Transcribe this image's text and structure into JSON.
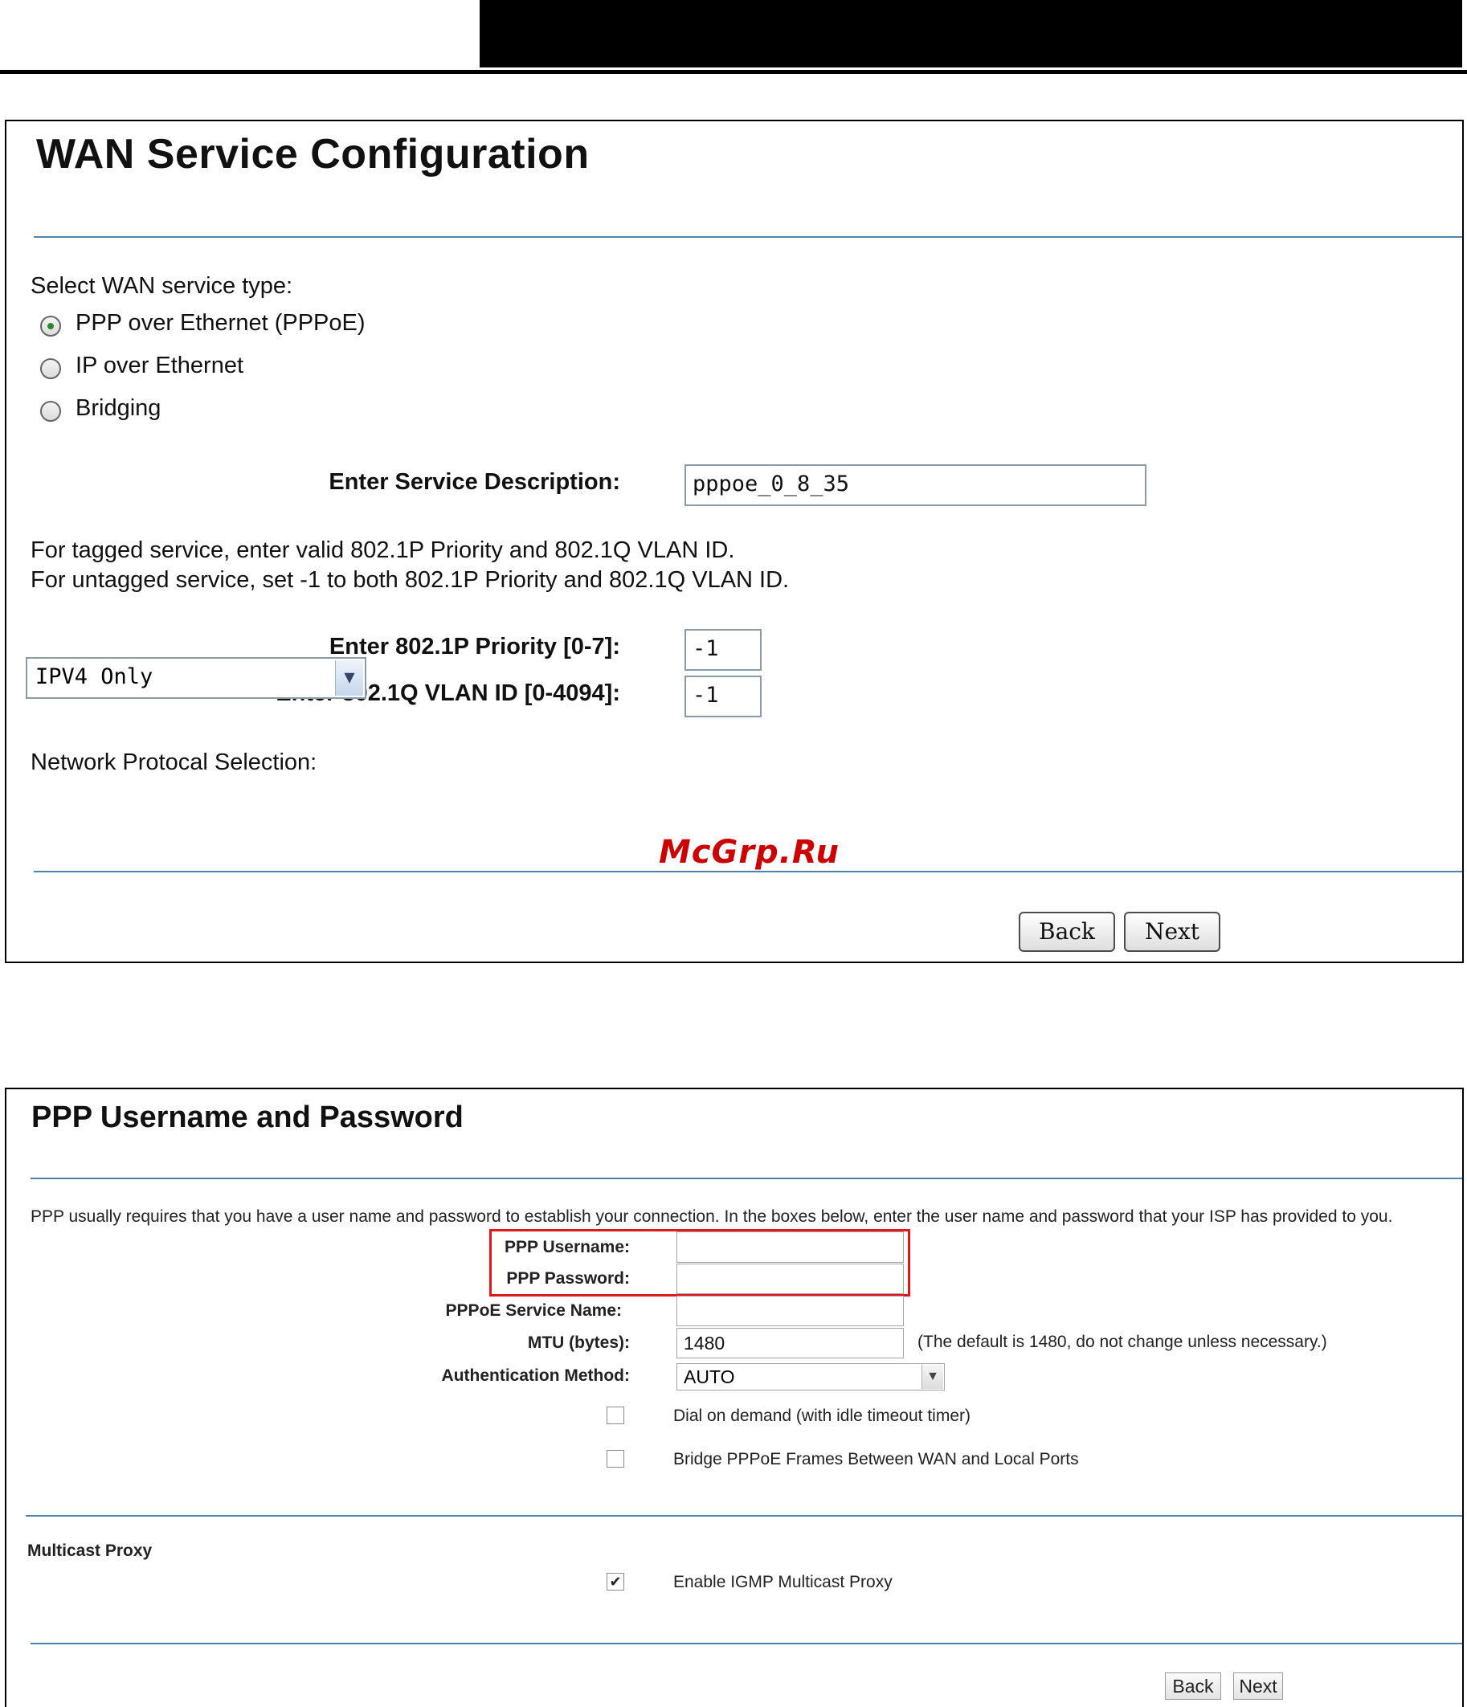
{
  "wan_service": {
    "title": "WAN Service Configuration",
    "select_label": "Select WAN service type:",
    "options": [
      {
        "label": "PPP over Ethernet (PPPoE)",
        "selected": true
      },
      {
        "label": "IP over Ethernet",
        "selected": false
      },
      {
        "label": "Bridging",
        "selected": false
      }
    ],
    "service_description_label": "Enter Service Description:",
    "service_description_value": "pppoe_0_8_35",
    "tagged_note": "For tagged service, enter valid 802.1P Priority and 802.1Q VLAN ID.",
    "untagged_note": "For untagged service, set -1 to both 802.1P Priority and 802.1Q VLAN ID.",
    "priority_label": "Enter 802.1P Priority [0-7]:",
    "priority_value": "-1",
    "vlan_label": "Enter 802.1Q VLAN ID [0-4094]:",
    "vlan_value": "-1",
    "protocol_label": "Network Protocal Selection:",
    "protocol_value": "IPV4 Only",
    "watermark": "McGrp.Ru",
    "back_label": "Back",
    "next_label": "Next"
  },
  "ppp": {
    "title": "PPP Username and Password",
    "intro": "PPP usually requires that you have a user name and password to establish your connection. In the boxes below, enter the user name and password that your ISP has provided to you.",
    "username_label": "PPP Username:",
    "username_value": "",
    "password_label": "PPP Password:",
    "password_value": "",
    "service_name_label": "PPPoE Service Name:",
    "service_name_value": "",
    "mtu_label": "MTU (bytes):",
    "mtu_value": "1480",
    "mtu_note": "(The default is 1480, do not change unless necessary.)",
    "auth_label": "Authentication Method:",
    "auth_value": "AUTO",
    "dial_on_demand_label": "Dial on demand (with idle timeout timer)",
    "dial_on_demand_checked": false,
    "bridge_label": "Bridge PPPoE Frames Between WAN and Local Ports",
    "bridge_checked": false,
    "multicast_heading": "Multicast Proxy",
    "igmp_label": "Enable IGMP Multicast Proxy",
    "igmp_checked": true,
    "back_label": "Back",
    "next_label": "Next"
  },
  "colors": {
    "rule": "#4b86a8",
    "highlight_box": "#e01818",
    "watermark": "#cc0000"
  }
}
